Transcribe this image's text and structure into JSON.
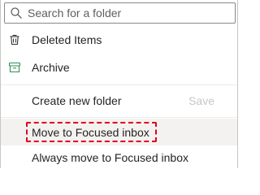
{
  "search": {
    "placeholder": "Search for a folder"
  },
  "items": {
    "deleted": {
      "label": "Deleted Items",
      "icon": "trash-icon"
    },
    "archive": {
      "label": "Archive",
      "icon": "archive-icon"
    },
    "create_folder": {
      "label": "Create new folder",
      "save_label": "Save"
    },
    "move_focused": {
      "label": "Move to Focused inbox"
    },
    "always_move_focused": {
      "label": "Always move to Focused inbox"
    }
  },
  "colors": {
    "archive_icon": "#2f8f5b",
    "highlight_outline": "#e0001a"
  }
}
